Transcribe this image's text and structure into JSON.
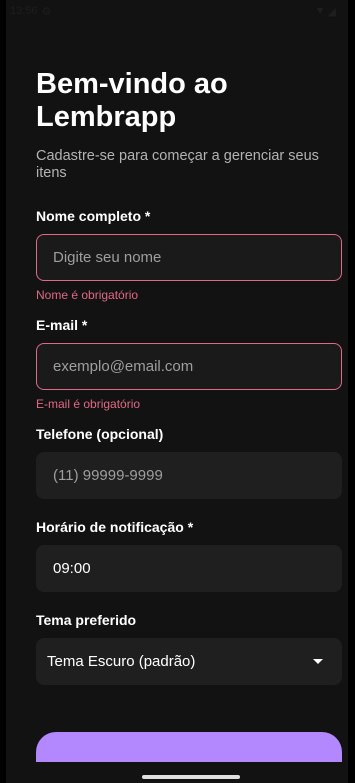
{
  "status": {
    "time": "13:56"
  },
  "header": {
    "title": "Bem-vindo ao Lembrapp",
    "subtitle": "Cadastre-se para começar a gerenciar seus itens"
  },
  "form": {
    "name": {
      "label": "Nome completo *",
      "placeholder": "Digite seu nome",
      "error": "Nome é obrigatório"
    },
    "email": {
      "label": "E-mail *",
      "placeholder": "exemplo@email.com",
      "error": "E-mail é obrigatório"
    },
    "phone": {
      "label": "Telefone (opcional)",
      "placeholder": "(11) 99999-9999"
    },
    "time": {
      "label": "Horário de notificação *",
      "value": "09:00"
    },
    "theme": {
      "label": "Tema preferido",
      "selected": "Tema Escuro (padrão)"
    }
  },
  "colors": {
    "accent": "#b388ff",
    "error": "#e06985",
    "background": "#121212"
  }
}
